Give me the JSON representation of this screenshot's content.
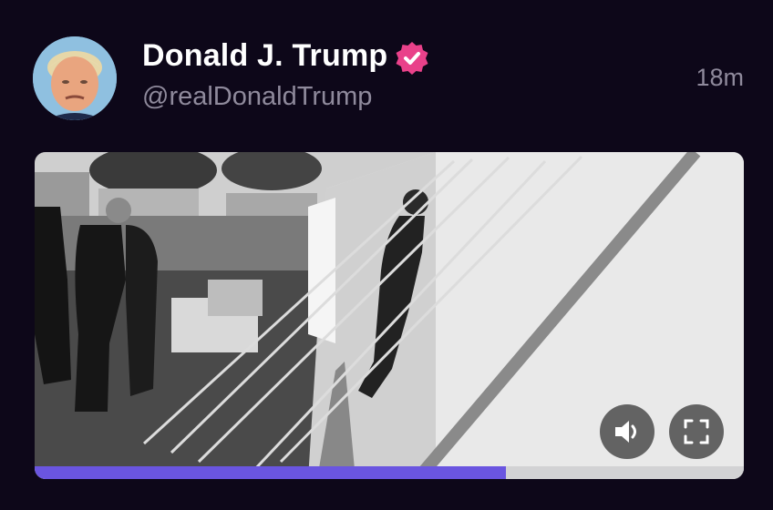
{
  "post": {
    "author": {
      "display_name": "Donald J. Trump",
      "handle": "@realDonaldTrump",
      "verified": true,
      "avatar_icon": "profile-photo"
    },
    "timestamp": "18m"
  },
  "video": {
    "progress": 0.665,
    "volume_icon": "speaker-icon",
    "fullscreen_icon": "fullscreen-icon",
    "colors": {
      "progress_fill": "#6a55e0",
      "progress_track": "#d2d2d4",
      "verified_badge": "#e9418a",
      "background": "#0d0719"
    }
  }
}
